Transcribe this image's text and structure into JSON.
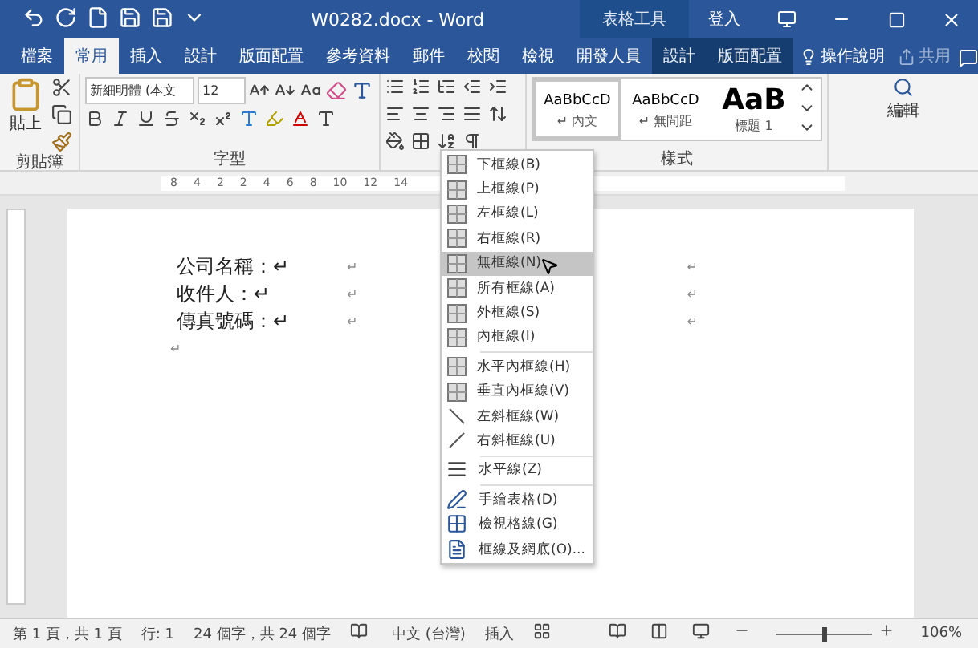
{
  "window": {
    "title": "W0282.docx - Word",
    "context_tab": "表格工具",
    "sign_in": "登入"
  },
  "tabs": [
    {
      "label": "檔案",
      "selected": false,
      "contextual": false
    },
    {
      "label": "常用",
      "selected": true,
      "contextual": false
    },
    {
      "label": "插入",
      "selected": false,
      "contextual": false
    },
    {
      "label": "設計",
      "selected": false,
      "contextual": false
    },
    {
      "label": "版面配置",
      "selected": false,
      "contextual": false
    },
    {
      "label": "參考資料",
      "selected": false,
      "contextual": false
    },
    {
      "label": "郵件",
      "selected": false,
      "contextual": false
    },
    {
      "label": "校閱",
      "selected": false,
      "contextual": false
    },
    {
      "label": "檢視",
      "selected": false,
      "contextual": false
    },
    {
      "label": "開發人員",
      "selected": false,
      "contextual": false
    },
    {
      "label": "設計",
      "selected": false,
      "contextual": true
    },
    {
      "label": "版面配置",
      "selected": false,
      "contextual": true
    }
  ],
  "tell_me": "操作說明",
  "share": "共用",
  "ribbon": {
    "paste": "貼上",
    "font_name": "新細明體 (本文",
    "font_size": "12",
    "editing": "編輯",
    "groups": [
      "剪貼簿",
      "字型",
      "樣式"
    ],
    "styles": [
      {
        "preview": "AaBbCcD",
        "name": "↵ 內文",
        "selected": true,
        "kind": "normal"
      },
      {
        "preview": "AaBbCcD",
        "name": "↵ 無間距",
        "selected": false,
        "kind": "normal"
      },
      {
        "preview": "AaB",
        "name": "標題 1",
        "selected": false,
        "kind": "heading"
      }
    ]
  },
  "ruler": [
    "8",
    "4",
    "2",
    "2",
    "4",
    "6",
    "8",
    "10",
    "12",
    "14"
  ],
  "document": {
    "rows": [
      {
        "label": "公司名稱：↵",
        "cell_mark": "↵"
      },
      {
        "label": "收件人：↵",
        "cell_mark": "↵"
      },
      {
        "label": "傳真號碼：↵",
        "cell_mark": "↵"
      }
    ],
    "end_mark": "↵",
    "right_marks": [
      "↵",
      "↵",
      "↵"
    ]
  },
  "border_menu": [
    [
      {
        "label": "下框線(B)",
        "selected": false
      },
      {
        "label": "上框線(P)",
        "selected": false
      },
      {
        "label": "左框線(L)",
        "selected": false
      },
      {
        "label": "右框線(R)",
        "selected": false
      },
      {
        "label": "無框線(N)",
        "selected": true
      },
      {
        "label": "所有框線(A)",
        "selected": false
      },
      {
        "label": "外框線(S)",
        "selected": false
      },
      {
        "label": "內框線(I)",
        "selected": false
      }
    ],
    [
      {
        "label": "水平內框線(H)",
        "selected": false
      },
      {
        "label": "垂直內框線(V)",
        "selected": false
      },
      {
        "label": "左斜框線(W)",
        "selected": false
      },
      {
        "label": "右斜框線(U)",
        "selected": false
      }
    ],
    [
      {
        "label": "水平線(Z)",
        "selected": false
      }
    ],
    [
      {
        "label": "手繪表格(D)",
        "selected": false
      },
      {
        "label": "檢視格線(G)",
        "selected": false
      },
      {
        "label": "框線及網底(O)...",
        "selected": false
      }
    ]
  ],
  "status_bar": {
    "page": "第 1 頁，共 1 頁",
    "line": "行: 1",
    "words": "24 個字，共 24 個字",
    "language": "中文 (台灣)",
    "mode": "插入",
    "zoom": "106%",
    "zoom_slider": {
      "level": 0.5
    }
  }
}
